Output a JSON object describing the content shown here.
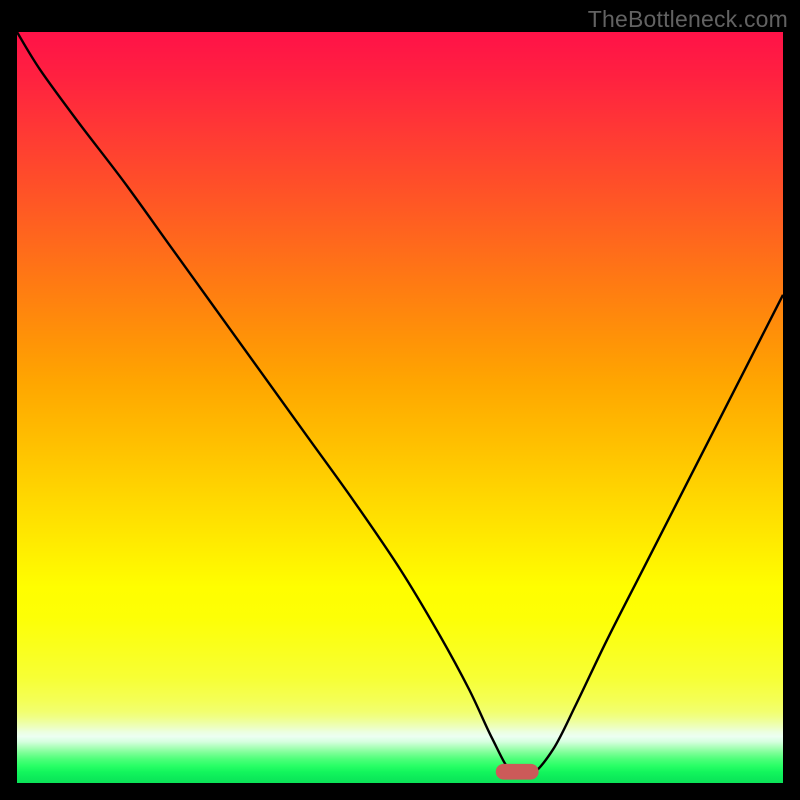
{
  "watermark": "TheBottleneck.com",
  "chart_data": {
    "type": "line",
    "title": "",
    "xlabel": "",
    "ylabel": "",
    "xlim": [
      0,
      100
    ],
    "ylim": [
      0,
      100
    ],
    "grid": false,
    "legend": false,
    "gradient_stops": [
      {
        "offset": 0.0,
        "color": "#ff1248"
      },
      {
        "offset": 0.06,
        "color": "#ff2140"
      },
      {
        "offset": 0.13,
        "color": "#ff3835"
      },
      {
        "offset": 0.2,
        "color": "#ff4e29"
      },
      {
        "offset": 0.27,
        "color": "#ff651e"
      },
      {
        "offset": 0.34,
        "color": "#ff7c12"
      },
      {
        "offset": 0.41,
        "color": "#ff9307"
      },
      {
        "offset": 0.47,
        "color": "#ffa700"
      },
      {
        "offset": 0.54,
        "color": "#ffbd00"
      },
      {
        "offset": 0.61,
        "color": "#ffd400"
      },
      {
        "offset": 0.68,
        "color": "#ffeb00"
      },
      {
        "offset": 0.74,
        "color": "#fffe00"
      },
      {
        "offset": 0.78,
        "color": "#fdff06"
      },
      {
        "offset": 0.82,
        "color": "#faff1d"
      },
      {
        "offset": 0.86,
        "color": "#f7ff35"
      },
      {
        "offset": 0.89,
        "color": "#f4ff56"
      },
      {
        "offset": 0.905,
        "color": "#f2ff6f"
      },
      {
        "offset": 0.912,
        "color": "#f0ff85"
      },
      {
        "offset": 0.92,
        "color": "#eeffa6"
      },
      {
        "offset": 0.926,
        "color": "#edffc2"
      },
      {
        "offset": 0.932,
        "color": "#ecffe0"
      },
      {
        "offset": 0.938,
        "color": "#ecfff2"
      },
      {
        "offset": 0.945,
        "color": "#d6ffdf"
      },
      {
        "offset": 0.953,
        "color": "#a6ffb6"
      },
      {
        "offset": 0.96,
        "color": "#7bff96"
      },
      {
        "offset": 0.968,
        "color": "#4eff7a"
      },
      {
        "offset": 0.977,
        "color": "#2aff66"
      },
      {
        "offset": 0.985,
        "color": "#13f65d"
      },
      {
        "offset": 0.992,
        "color": "#0dec5a"
      },
      {
        "offset": 1.0,
        "color": "#0be258"
      }
    ],
    "series": [
      {
        "name": "bottleneck-curve",
        "color": "#000000",
        "x": [
          0.0,
          3.0,
          8.0,
          14.0,
          20.0,
          26.0,
          32.0,
          38.0,
          44.0,
          50.0,
          55.0,
          59.0,
          62.0,
          64.5,
          67.0,
          70.0,
          73.0,
          77.0,
          82.0,
          88.0,
          94.0,
          100.0
        ],
        "y": [
          100.0,
          95.0,
          88.0,
          80.0,
          71.5,
          63.0,
          54.5,
          46.0,
          37.5,
          28.5,
          20.0,
          12.5,
          6.0,
          1.5,
          1.0,
          4.5,
          10.5,
          19.0,
          29.0,
          41.0,
          53.0,
          65.0
        ]
      }
    ],
    "marker": {
      "name": "optimal-marker",
      "x": 65.3,
      "y": 1.5,
      "color": "#cc5a59",
      "width_pct": 5.6,
      "height_pct": 2.1
    }
  }
}
